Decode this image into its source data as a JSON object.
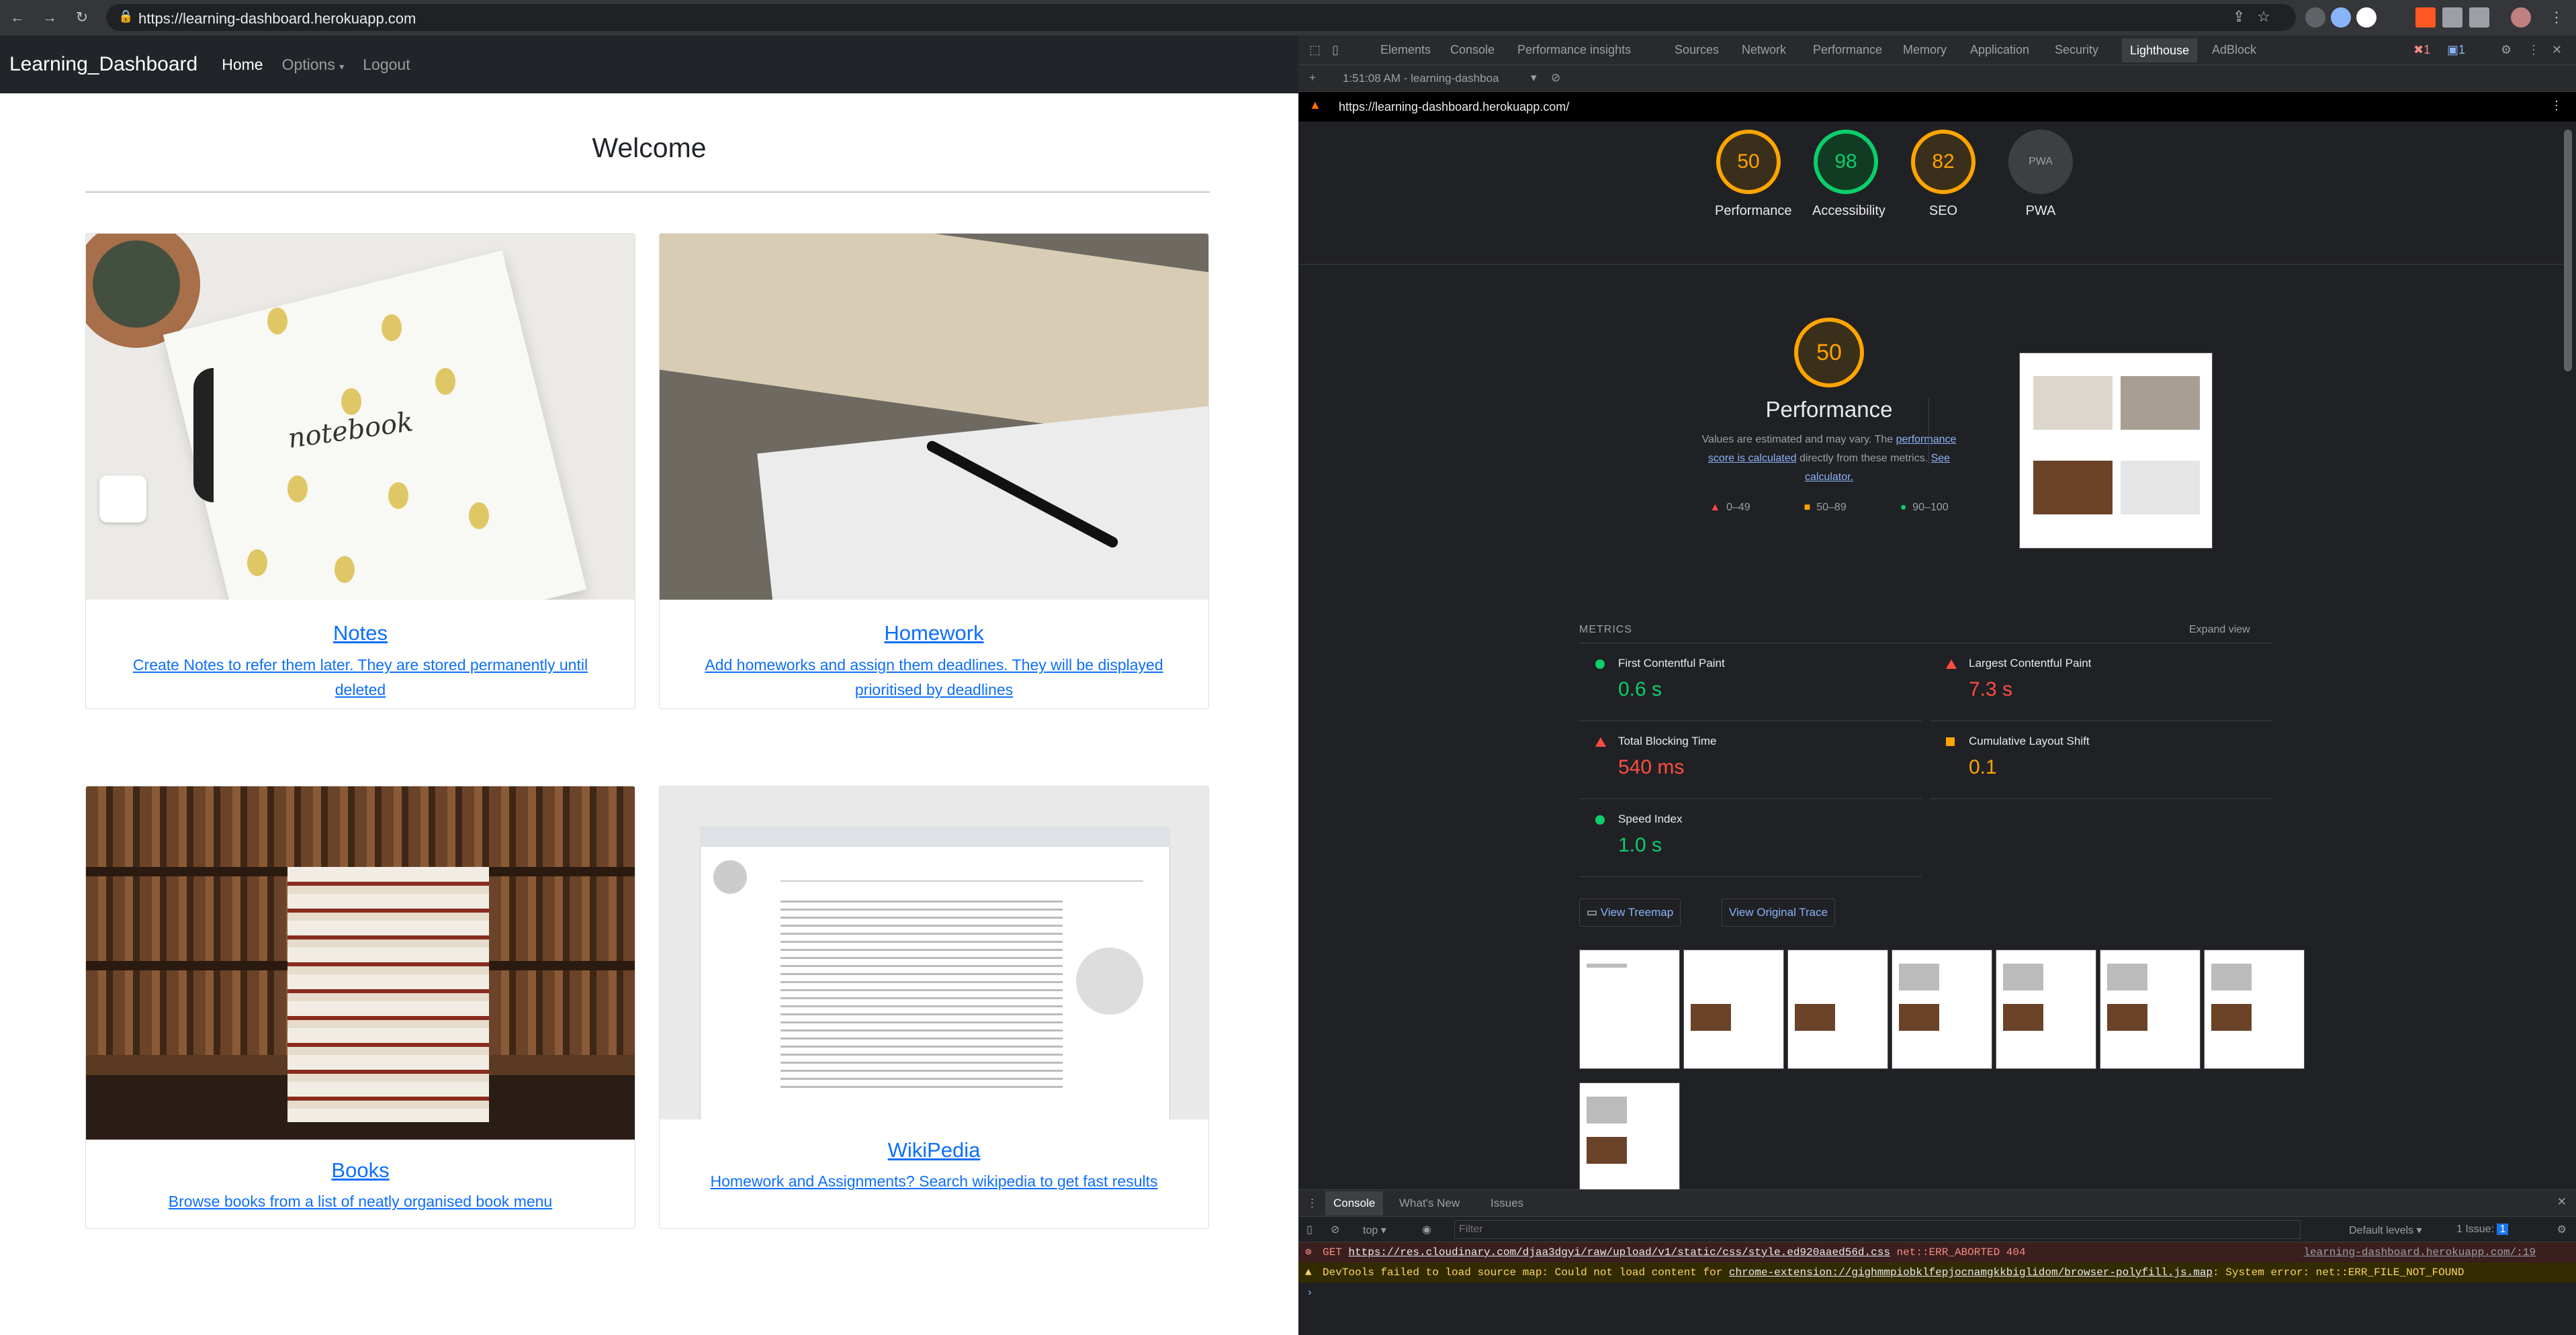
{
  "browser": {
    "url": "https://learning-dashboard.herokuapp.com"
  },
  "app": {
    "brand": "Learning_Dashboard",
    "nav": [
      "Home",
      "Options",
      "Logout"
    ],
    "welcome": "Welcome",
    "cards": [
      {
        "title": "Notes",
        "text": "Create Notes to refer them later. They are stored permanently until deleted"
      },
      {
        "title": "Homework",
        "text": "Add homeworks and assign them deadlines. They will be displayed prioritised by deadlines"
      },
      {
        "title": "Books",
        "text": "Browse books from a list of neatly organised book menu"
      },
      {
        "title": "WikiPedia",
        "text": "Homework and Assignments? Search wikipedia to get fast results"
      }
    ],
    "notebook_word": "notebook"
  },
  "devtools": {
    "tabs": [
      "Elements",
      "Console",
      "Performance insights",
      "Sources",
      "Network",
      "Performance",
      "Memory",
      "Application",
      "Security",
      "Lighthouse",
      "AdBlock"
    ],
    "selected_tab": "Lighthouse",
    "report_time": "1:51:08 AM - learning-dashboa",
    "report_url": "https://learning-dashboard.herokuapp.com/",
    "gauges": [
      {
        "value": "50",
        "label": "Performance",
        "color": "#ffa400"
      },
      {
        "value": "98",
        "label": "Accessibility",
        "color": "#0cce6b"
      },
      {
        "value": "82",
        "label": "SEO",
        "color": "#ffa400"
      },
      {
        "value": "PWA",
        "label": "PWA",
        "color": "#9aa0a6"
      }
    ],
    "perf": {
      "score": "50",
      "title": "Performance",
      "desc1": "Values are estimated and may vary. The ",
      "link1": "performance score is calculated",
      "desc2": " directly from these metrics. ",
      "link2": "See calculator.",
      "legend": [
        "0–49",
        "50–89",
        "90–100"
      ]
    },
    "metrics_title": "METRICS",
    "expand": "Expand view",
    "metrics": [
      {
        "name": "First Contentful Paint",
        "value": "0.6 s",
        "status": "good"
      },
      {
        "name": "Largest Contentful Paint",
        "value": "7.3 s",
        "status": "bad"
      },
      {
        "name": "Total Blocking Time",
        "value": "540 ms",
        "status": "bad"
      },
      {
        "name": "Cumulative Layout Shift",
        "value": "0.1",
        "status": "avg"
      },
      {
        "name": "Speed Index",
        "value": "1.0 s",
        "status": "good"
      }
    ],
    "buttons": [
      "View Treemap",
      "View Original Trace"
    ],
    "drawer": {
      "tabs": [
        "Console",
        "What's New",
        "Issues"
      ],
      "context": "top",
      "filter_placeholder": "Filter",
      "levels": "Default levels",
      "issues": "1 Issue:",
      "issues_count": "1",
      "err1_prefix": "GET ",
      "err1_link": "https://res.cloudinary.com/djaa3dgyi/raw/upload/v1/static/css/style.ed920aaed56d.css",
      "err1_msg": " net::ERR_ABORTED 404",
      "err1_src": "learning-dashboard.herokuapp.com/:19",
      "warn1_prefix": "DevTools failed to load source map: Could not load content for ",
      "warn1_link": "chrome-extension://gighmmpiobklfepjocnamgkkbiglidom/browser-polyfill.js.map",
      "warn1_msg": ": System error: net::ERR_FILE_NOT_FOUND"
    }
  }
}
